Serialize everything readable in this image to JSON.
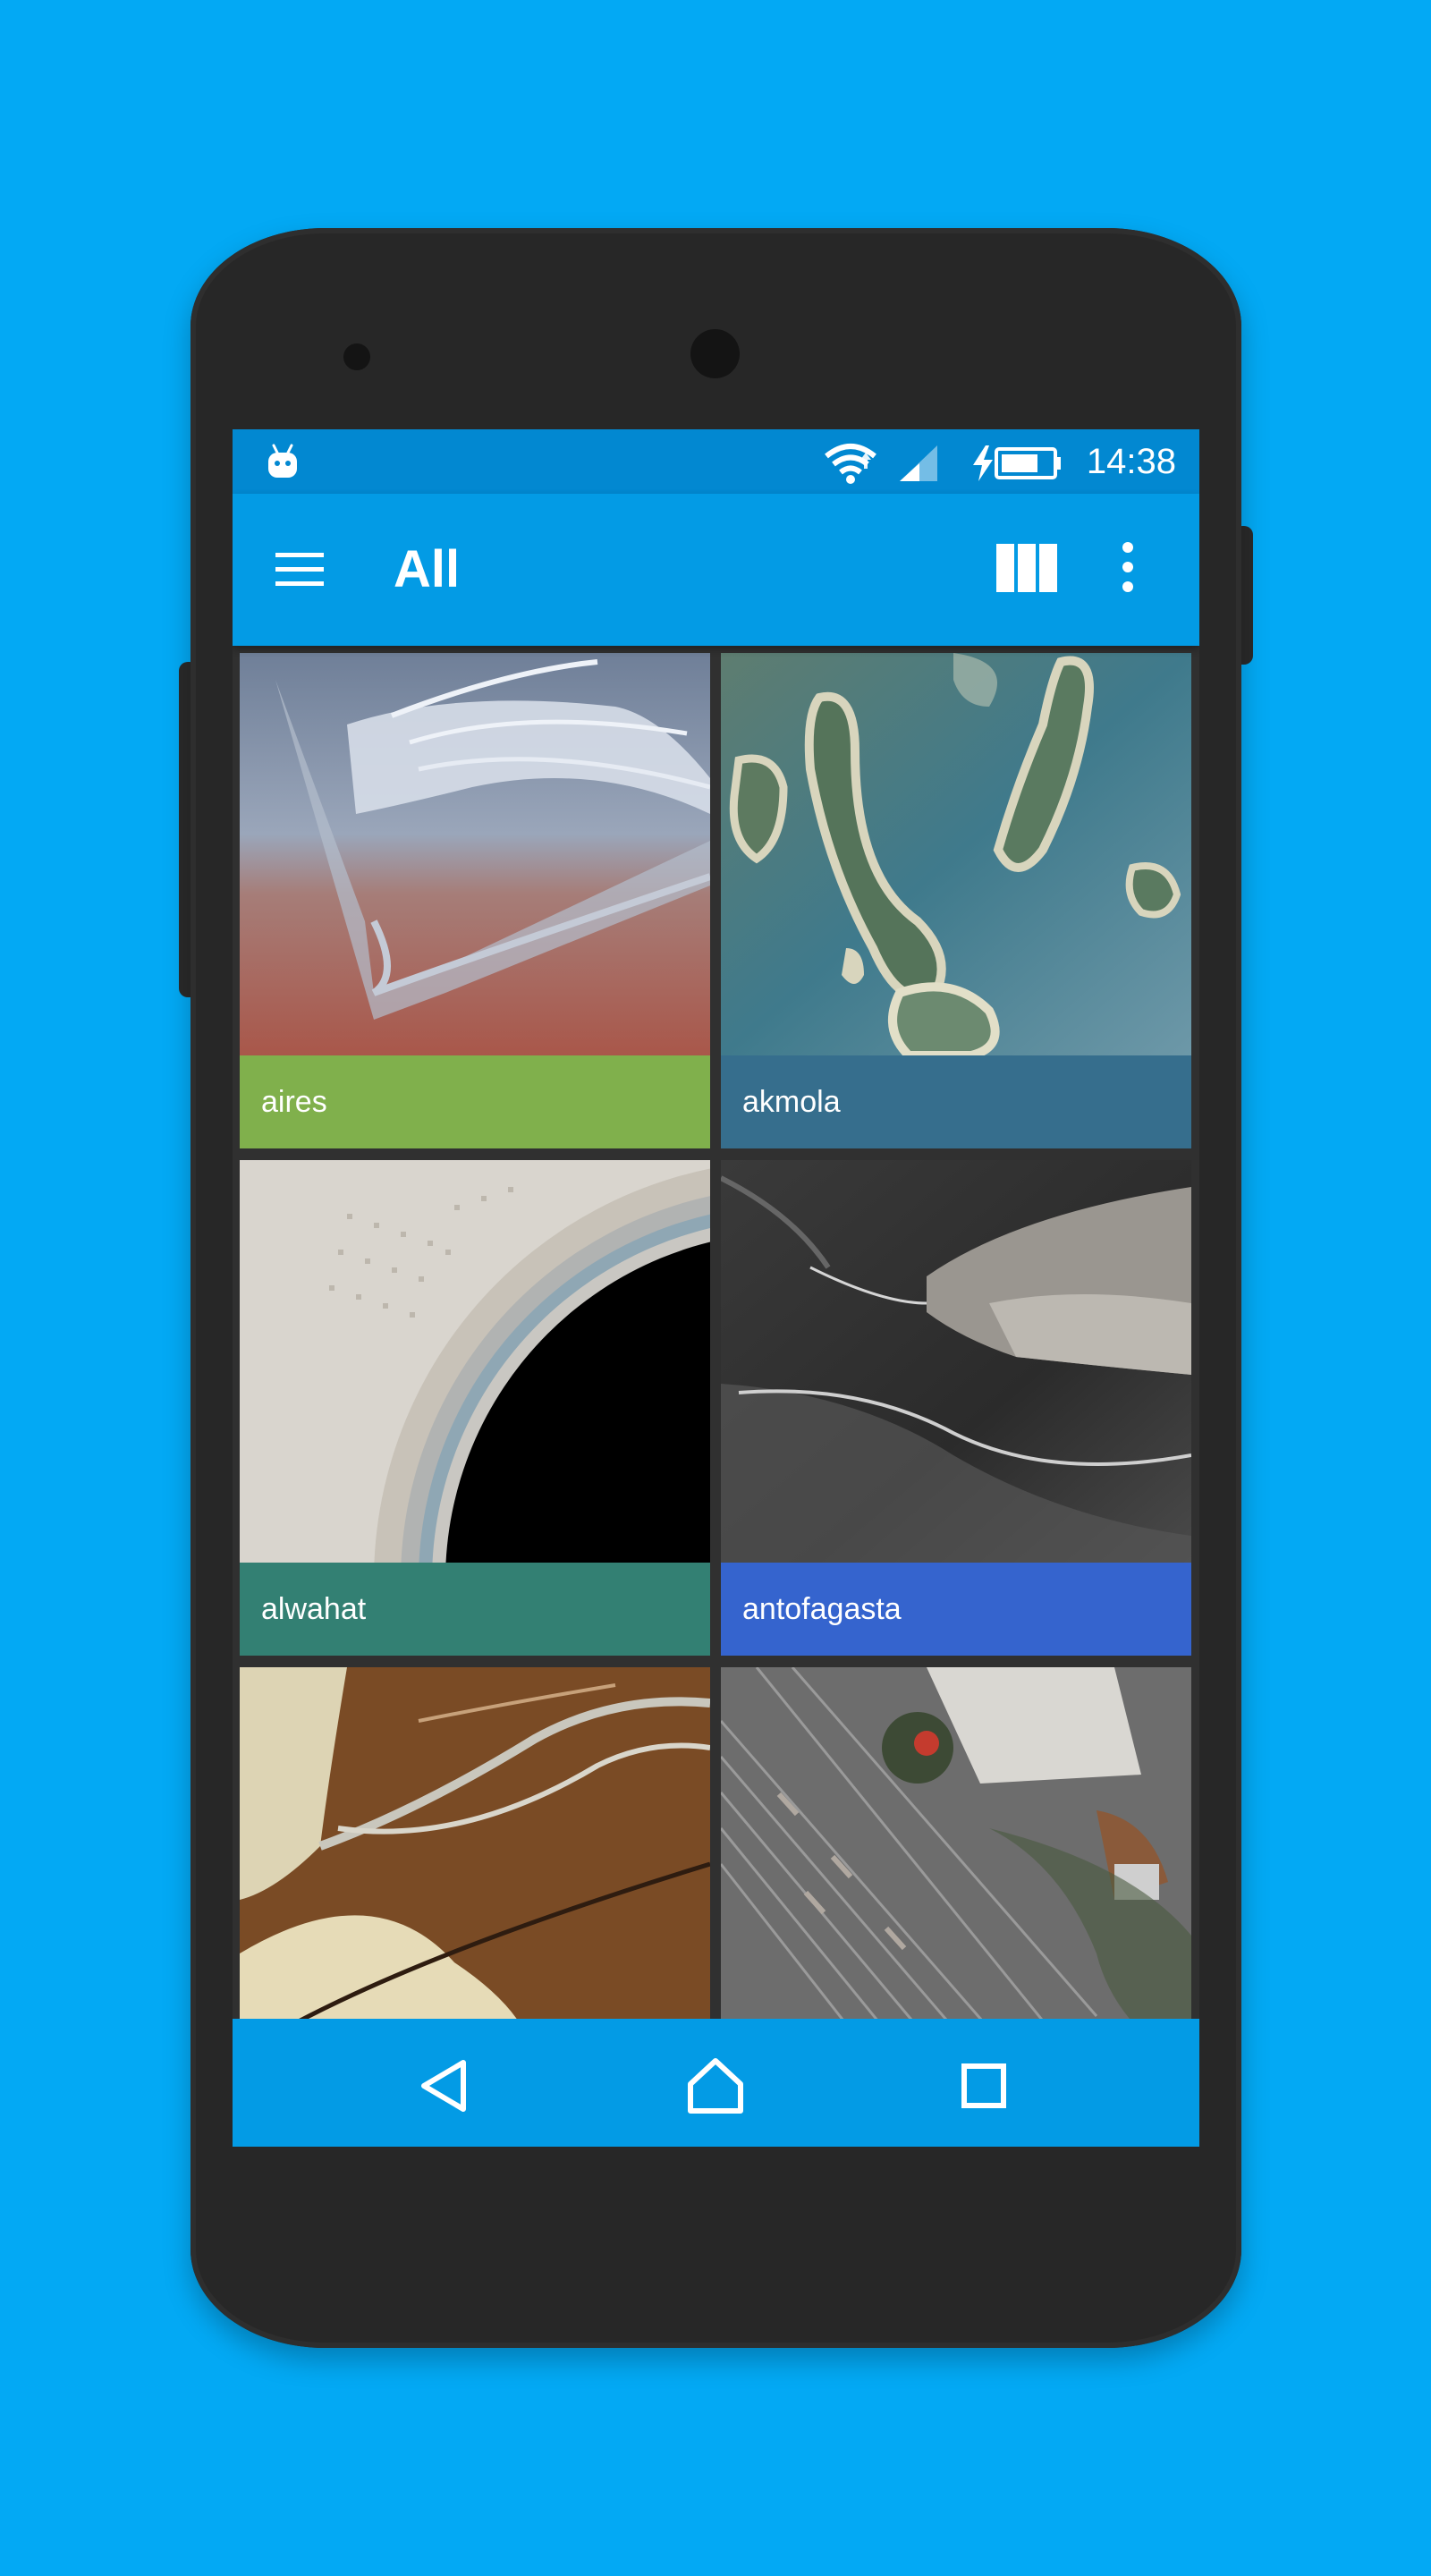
{
  "colors": {
    "page_background": "#03A9F4",
    "phone_body": "#272727",
    "status_bar": "#0288D1",
    "app_bar": "#039BE5",
    "nav_bar": "#039BE5",
    "grid_background": "#303030"
  },
  "status_bar": {
    "time": "14:38",
    "icons": [
      "android-icon",
      "wifi-icon",
      "cellular-signal-icon",
      "battery-charging-icon"
    ]
  },
  "app_bar": {
    "title": "All",
    "icons": [
      "hamburger-menu-icon",
      "grid-columns-icon",
      "more-vert-icon"
    ]
  },
  "gallery": {
    "items": [
      {
        "label": "aires",
        "caption_color": "#80B04C"
      },
      {
        "label": "akmola",
        "caption_color": "#366E8D"
      },
      {
        "label": "alwahat",
        "caption_color": "#338073"
      },
      {
        "label": "antofagasta",
        "caption_color": "#3564CE"
      },
      {
        "label": "",
        "caption_color": ""
      },
      {
        "label": "",
        "caption_color": ""
      }
    ]
  },
  "nav_bar": {
    "icons": [
      "back-triangle-icon",
      "home-icon",
      "recents-square-icon"
    ]
  }
}
